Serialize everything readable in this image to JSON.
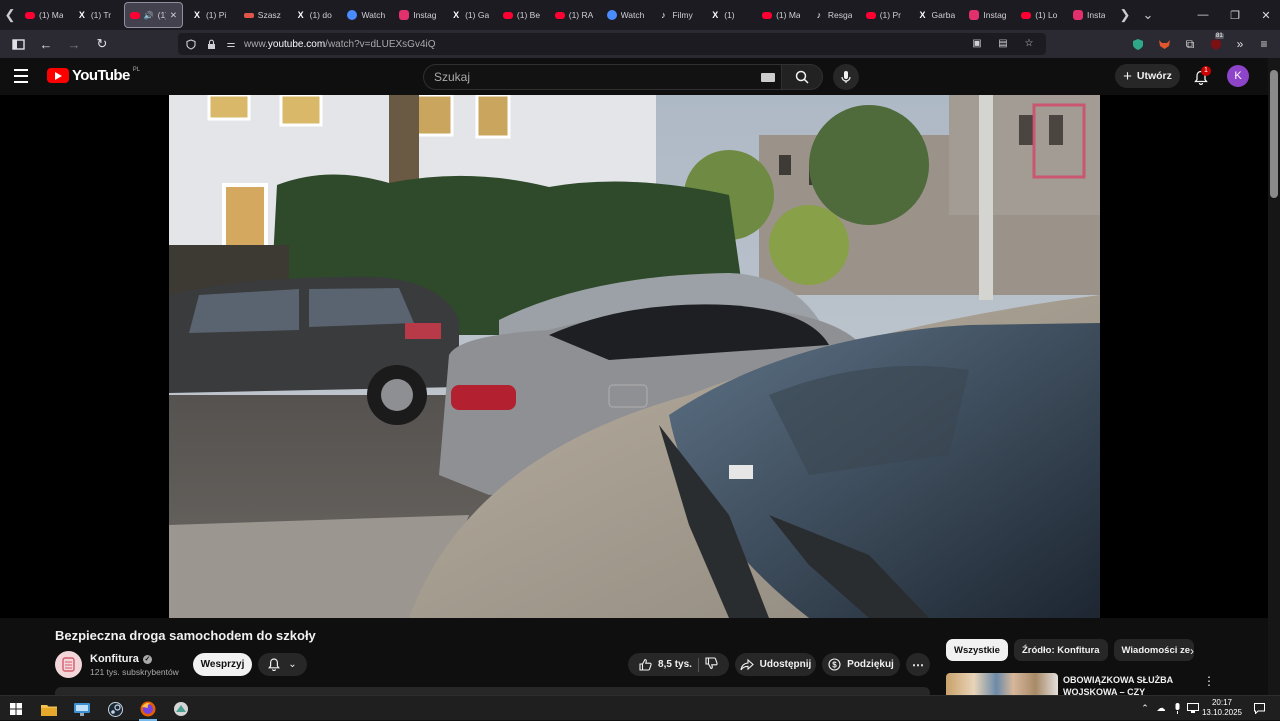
{
  "browser": {
    "tabs": [
      {
        "label": "(1) Ma",
        "icon": "youtube-icon",
        "color": "#ff0033"
      },
      {
        "label": "(1) Tr",
        "icon": "x-icon",
        "color": "#ffffff"
      },
      {
        "label": "(1)",
        "icon": "youtube-icon",
        "color": "#ff0033",
        "active": true
      },
      {
        "label": "(1) Pi",
        "icon": "x-icon",
        "color": "#ffffff"
      },
      {
        "label": "Szasz",
        "icon": "generic-site-icon",
        "color": "#e0554a"
      },
      {
        "label": "(1) do",
        "icon": "x-icon",
        "color": "#ffffff"
      },
      {
        "label": "Watch",
        "icon": "watch-party-icon",
        "color": "#4a8cff"
      },
      {
        "label": "Instag",
        "icon": "instagram-icon",
        "color": "#e1306c"
      },
      {
        "label": "(1) Ga",
        "icon": "x-icon",
        "color": "#ffffff"
      },
      {
        "label": "(1) Be",
        "icon": "youtube-icon",
        "color": "#ff0033"
      },
      {
        "label": "(1) RA",
        "icon": "youtube-icon",
        "color": "#ff0033"
      },
      {
        "label": "Watch",
        "icon": "watch-party-icon",
        "color": "#4a8cff"
      },
      {
        "label": "Filmy",
        "icon": "tiktok-icon",
        "color": "#ffffff"
      },
      {
        "label": "(1)",
        "icon": "x-icon",
        "color": "#ffffff"
      },
      {
        "label": "(1) Ma",
        "icon": "youtube-icon",
        "color": "#ff0033"
      },
      {
        "label": "Resga",
        "icon": "tiktok-icon",
        "color": "#ffffff"
      },
      {
        "label": "(1) Pr",
        "icon": "youtube-icon",
        "color": "#ff0033"
      },
      {
        "label": "Garba",
        "icon": "x-icon",
        "color": "#ffffff"
      },
      {
        "label": "Instag",
        "icon": "instagram-icon",
        "color": "#e1306c"
      },
      {
        "label": "(1) Lo",
        "icon": "youtube-icon",
        "color": "#ff0033"
      },
      {
        "label": "Insta",
        "icon": "instagram-icon",
        "color": "#e1306c"
      }
    ],
    "url_prefix": "www.",
    "url_host": "youtube.com",
    "url_path": "/watch?v=dLUEXsGv4iQ",
    "extension_badge": "81"
  },
  "youtube": {
    "logo_text": "YouTube",
    "region": "PL",
    "search_placeholder": "Szukaj",
    "create_label": "Utwórz",
    "notification_count": "1",
    "avatar_letter": "K"
  },
  "video": {
    "title": "Bezpieczna droga samochodem do szkoły",
    "channel_name": "Konfitura",
    "subscribers": "121 tys. subskrybentów",
    "join_label": "Wesprzyj",
    "likes": "8,5 tys.",
    "share_label": "Udostępnij",
    "thanks_label": "Podziękuj"
  },
  "sidebar": {
    "chips": [
      "Wszystkie",
      "Źródło: Konfitura",
      "Wiadomości ze"
    ],
    "rec_title": "OBOWIĄZKOWA SŁUŻBA WOJSKOWA – CZY KOBIETY"
  },
  "taskbar": {
    "time": "20:17",
    "date": "13.10.2025"
  },
  "colors": {
    "yt_bg": "#0f0f0f",
    "brand_red": "#ff0000",
    "avatar": "#8e44c9"
  }
}
